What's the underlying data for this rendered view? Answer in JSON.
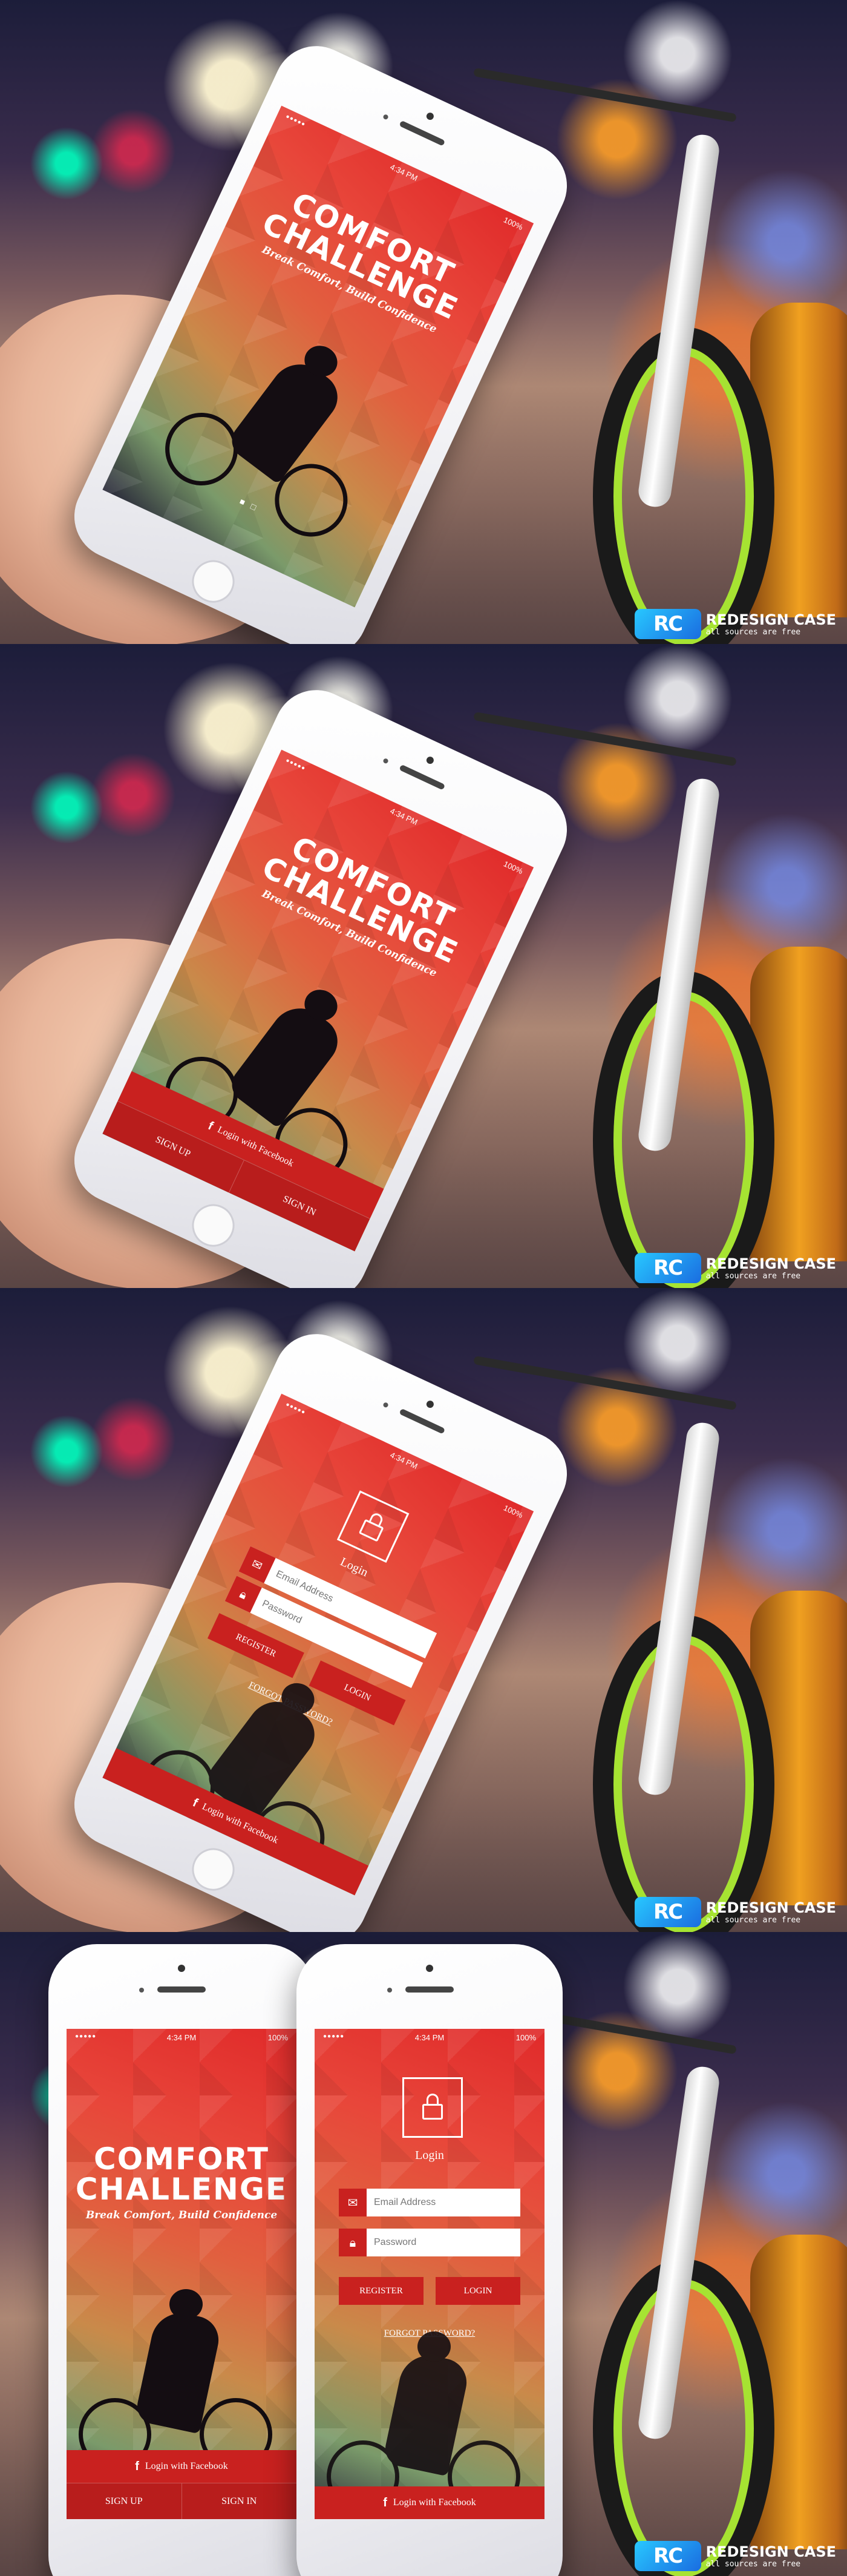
{
  "status": {
    "time": "4:34 PM",
    "battery": "100%",
    "signal": "●●●●●"
  },
  "splash": {
    "logo_line1": "COMFORT",
    "logo_line2": "CHALLENGE",
    "tagline": "Break Comfort, Build Confidence",
    "page_indicator": "■ □"
  },
  "welcome": {
    "facebook_login": "Login with Facebook",
    "signup": "SIGN UP",
    "signin": "SIGN IN"
  },
  "login": {
    "title": "Login",
    "email_placeholder": "Email Address",
    "password_placeholder": "Password",
    "register": "REGISTER",
    "login_button": "LOGIN",
    "forgot": "FORGOT PASSWORD?",
    "facebook_login": "Login with Facebook"
  },
  "brand": {
    "mark": "RC",
    "name": "REDESIGN CASE",
    "subtitle": "all sources are free"
  },
  "colors": {
    "accent": "#c9211f",
    "tire": "#a6e332",
    "brand": "#1a9ce0"
  }
}
